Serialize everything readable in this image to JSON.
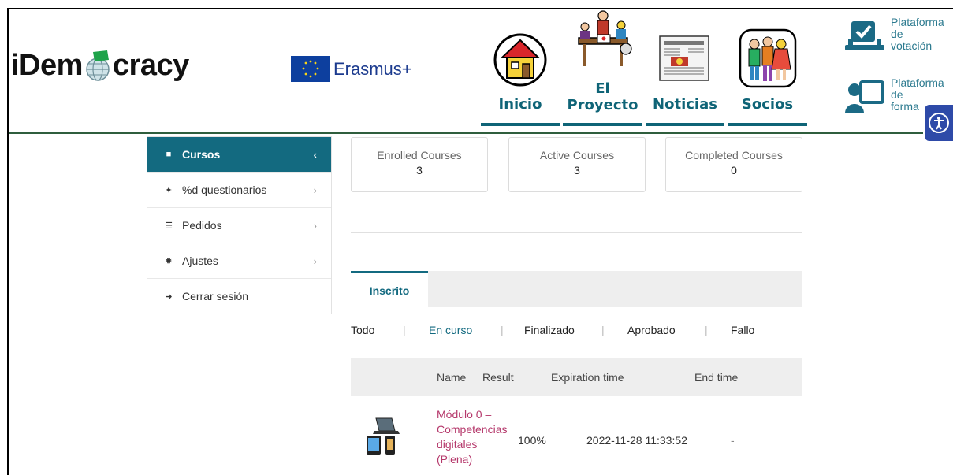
{
  "header": {
    "logo_left": "iDem",
    "logo_right": "cracy",
    "program": "Erasmus+",
    "nav": [
      {
        "label": "Inicio",
        "icon": "house-icon"
      },
      {
        "label": "El\nProyecto",
        "icon": "meeting-icon"
      },
      {
        "label": "Noticias",
        "icon": "newspaper-icon"
      },
      {
        "label": "Socios",
        "icon": "partners-icon"
      }
    ],
    "platforms": [
      {
        "label": "Plataforma\nde\nvotación",
        "icon": "voting-checkbox-icon"
      },
      {
        "label": "Plataforma\nde\nforma",
        "icon": "training-presentation-icon"
      }
    ],
    "colors": {
      "nav": "#0f6477",
      "accent": "#136a80",
      "course_link": "#b5386b"
    }
  },
  "sidebar": {
    "items": [
      {
        "label": "Cursos",
        "icon": "book-icon",
        "chevron": "‹"
      },
      {
        "label": "%d questionarios",
        "icon": "puzzle-icon",
        "chevron": "›"
      },
      {
        "label": "Pedidos",
        "icon": "cart-icon",
        "chevron": "›"
      },
      {
        "label": "Ajustes",
        "icon": "gear-icon",
        "chevron": "›"
      },
      {
        "label": "Cerrar sesión",
        "icon": "logout-icon",
        "chevron": ""
      }
    ]
  },
  "stats": [
    {
      "label": "Enrolled Courses",
      "value": "3"
    },
    {
      "label": "Active Courses",
      "value": "3"
    },
    {
      "label": "Completed Courses",
      "value": "0"
    }
  ],
  "tabs": {
    "active": "Inscrito"
  },
  "filters": {
    "all": "Todo",
    "in_progress": "En curso",
    "finished": "Finalizado",
    "passed": "Aprobado",
    "failed": "Fallo",
    "separator": "|"
  },
  "table": {
    "headers": {
      "name": "Name",
      "result": "Result",
      "expiration": "Expiration time",
      "end": "End time"
    },
    "rows": [
      {
        "name": "Módulo 0 – Competencias digitales (Plena)",
        "result": "100%",
        "expiration": "2022-11-28 11:33:52",
        "end": "-",
        "icon": "devices-icon"
      }
    ]
  }
}
